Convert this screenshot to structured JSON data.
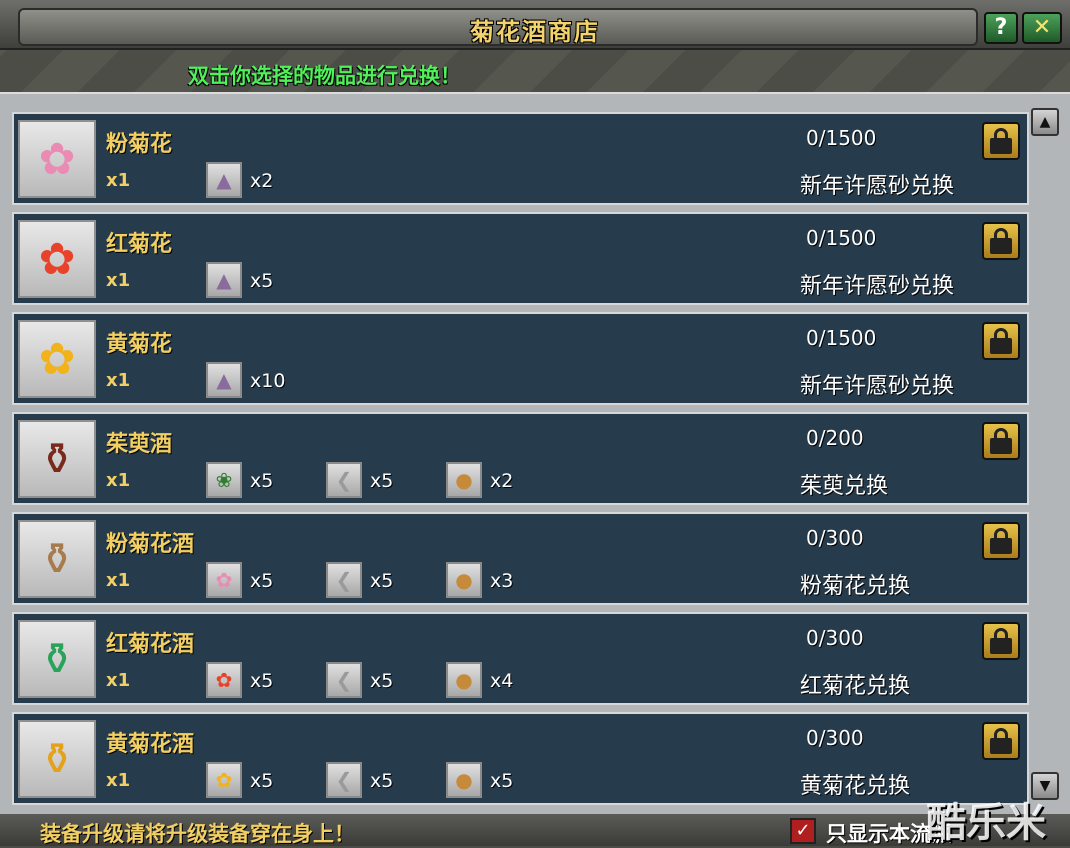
{
  "window": {
    "title": "菊花酒商店",
    "help_label": "?",
    "close_label": "✕",
    "instruction": "双击你选择的物品进行兑换！"
  },
  "items": [
    {
      "name": "粉菊花",
      "qty": "x1",
      "limit": "0/1500",
      "method": "新年许愿砂兑换",
      "icon": "pink-chrysanthemum-icon",
      "materials": [
        {
          "icon": "wish-sand-icon",
          "count": "x2"
        }
      ]
    },
    {
      "name": "红菊花",
      "qty": "x1",
      "limit": "0/1500",
      "method": "新年许愿砂兑换",
      "icon": "red-chrysanthemum-icon",
      "materials": [
        {
          "icon": "wish-sand-icon",
          "count": "x5"
        }
      ]
    },
    {
      "name": "黄菊花",
      "qty": "x1",
      "limit": "0/1500",
      "method": "新年许愿砂兑换",
      "icon": "yellow-chrysanthemum-icon",
      "materials": [
        {
          "icon": "wish-sand-icon",
          "count": "x10"
        }
      ]
    },
    {
      "name": "茱萸酒",
      "qty": "x1",
      "limit": "0/200",
      "method": "茱萸兑换",
      "icon": "dogwood-wine-jar-icon",
      "materials": [
        {
          "icon": "dogwood-herb-icon",
          "count": "x5"
        },
        {
          "icon": "silver-leaf-icon",
          "count": "x5"
        },
        {
          "icon": "bread-icon",
          "count": "x2"
        }
      ]
    },
    {
      "name": "粉菊花酒",
      "qty": "x1",
      "limit": "0/300",
      "method": "粉菊花兑换",
      "icon": "pink-wine-ewer-icon",
      "materials": [
        {
          "icon": "pink-chrysanthemum-icon",
          "count": "x5"
        },
        {
          "icon": "silver-leaf-icon",
          "count": "x5"
        },
        {
          "icon": "bread-icon",
          "count": "x3"
        }
      ]
    },
    {
      "name": "红菊花酒",
      "qty": "x1",
      "limit": "0/300",
      "method": "红菊花兑换",
      "icon": "green-wine-vase-icon",
      "materials": [
        {
          "icon": "red-chrysanthemum-icon",
          "count": "x5"
        },
        {
          "icon": "silver-leaf-icon",
          "count": "x5"
        },
        {
          "icon": "bread-icon",
          "count": "x4"
        }
      ]
    },
    {
      "name": "黄菊花酒",
      "qty": "x1",
      "limit": "0/300",
      "method": "黄菊花兑换",
      "icon": "gold-wine-ewer-icon",
      "materials": [
        {
          "icon": "yellow-chrysanthemum-icon",
          "count": "x5"
        },
        {
          "icon": "silver-leaf-icon",
          "count": "x5"
        },
        {
          "icon": "bread-icon",
          "count": "x5"
        }
      ]
    }
  ],
  "footer": {
    "hint": "装备升级请将升级装备穿在身上！",
    "checkbox_label": "只显示本流派",
    "watermark": "酷乐米"
  },
  "colors": {
    "row_bg": "#263b4c",
    "gold_text": "#f1cf62",
    "instruction_green": "#4ff05a",
    "checkbox_red": "#b01f1f"
  }
}
